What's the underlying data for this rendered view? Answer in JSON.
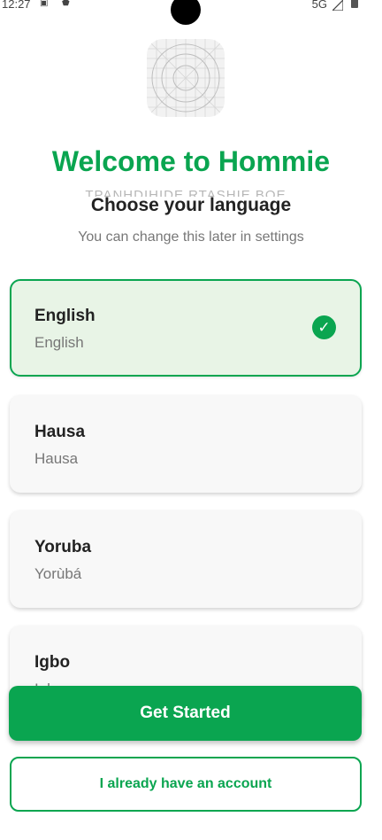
{
  "status_bar": {
    "time": "12:27",
    "network": "5G"
  },
  "header": {
    "title": "Welcome to Hommie",
    "ghost_text": "TPANHDIHIDE RTASHIE BOE PHOTOGPARPOUT",
    "subtitle": "Choose your language",
    "hint": "You can change this later in settings"
  },
  "languages": [
    {
      "name": "English",
      "native": "English",
      "selected": true
    },
    {
      "name": "Hausa",
      "native": "Hausa",
      "selected": false
    },
    {
      "name": "Yoruba",
      "native": "Yorùbá",
      "selected": false
    },
    {
      "name": "Igbo",
      "native": "Igbo",
      "selected": false
    }
  ],
  "actions": {
    "primary_label": "Get Started",
    "secondary_label": "I already have an account"
  },
  "colors": {
    "brand": "#0aa550",
    "selected_bg": "#e8f4e6"
  }
}
